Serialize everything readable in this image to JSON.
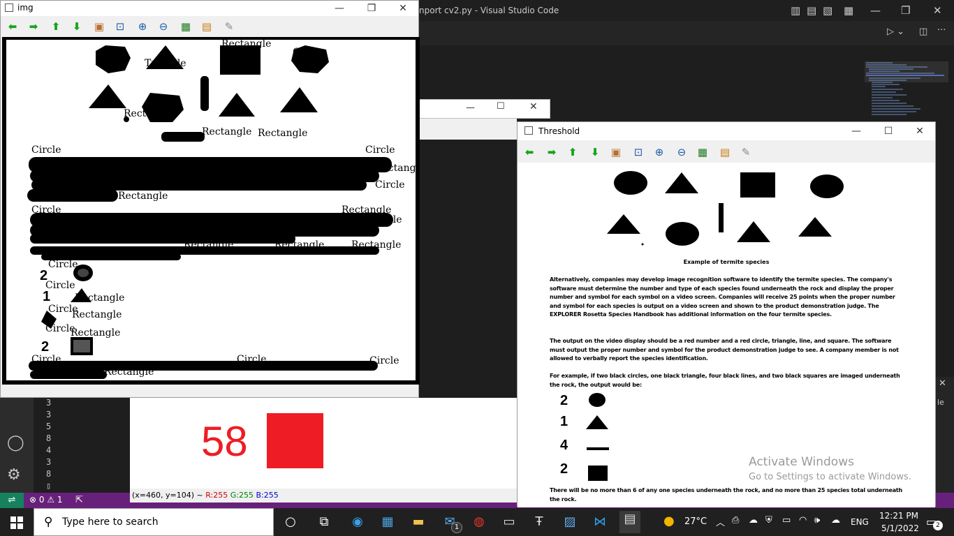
{
  "vscode": {
    "title": "nport cv2.py - Visual Studio Code",
    "line_numbers": [
      "3",
      "3",
      "5",
      "8",
      "4",
      "3",
      "8"
    ],
    "status_problems": "⊗ 0 ⚠ 1"
  },
  "img_window": {
    "title": "img",
    "labels": [
      "Rectangle",
      "Circle",
      "Triangle",
      "Rectangle",
      "Rectangle",
      "Circle",
      "Circle",
      "Rectangle",
      "Circle",
      "Rectangle",
      "Circle",
      "Rectangle",
      "Circle",
      "Rectangle",
      "Rectangle",
      "Rectangle",
      "Rectangle",
      "Circle",
      "Circle",
      "Circle",
      "Circle",
      "Circle",
      "Circle",
      "Circle",
      "Circle",
      "Circle",
      "Circle",
      "Circle",
      "Circle",
      "Rectangle",
      "Rectangle"
    ],
    "status": {
      "coords": "(x=460, y=104) ~",
      "r": "R:255",
      "g": "G:255",
      "b": "B:255"
    }
  },
  "output": {
    "number": "58",
    "square_color": "#ee1c24"
  },
  "threshold_window": {
    "title": "Threshold",
    "caption": "Example of termite species",
    "paragraph1": "Alternatively, companies may develop image recognition software to identify the termite species. The company's software must determine the number and type of each species found underneath the rock and display the proper number and symbol for each symbol on a video screen. Companies will receive 25 points when the proper number and symbol for each species is output on a video screen and shown to the product demonstration judge. The EXPLORER Rosetta Species Handbook has additional information on the four termite species.",
    "paragraph2": "The output on the video display should be a red number and a red circle, triangle, line, and square. The software must output the proper number and symbol for the product demonstration judge to see. A company member is not allowed to verbally report the species identification.",
    "paragraph3": "For example, if two black circles, one black triangle, four black lines, and two black squares are imaged underneath the rock, the output would be:",
    "symbols": [
      "2",
      "1",
      "4",
      "2"
    ],
    "paragraph4": "There will be no more than 6 of any one species underneath the rock, and no more than 25 species total underneath the rock."
  },
  "activate": {
    "line1": "Activate Windows",
    "line2": "Go to Settings to activate Windows."
  },
  "taskbar": {
    "search_placeholder": "Type here to search",
    "weather": "27°C",
    "language": "ENG",
    "time": "12:21 PM",
    "date": "5/1/2022",
    "mail_badge": "1",
    "notification_badge": "2"
  }
}
